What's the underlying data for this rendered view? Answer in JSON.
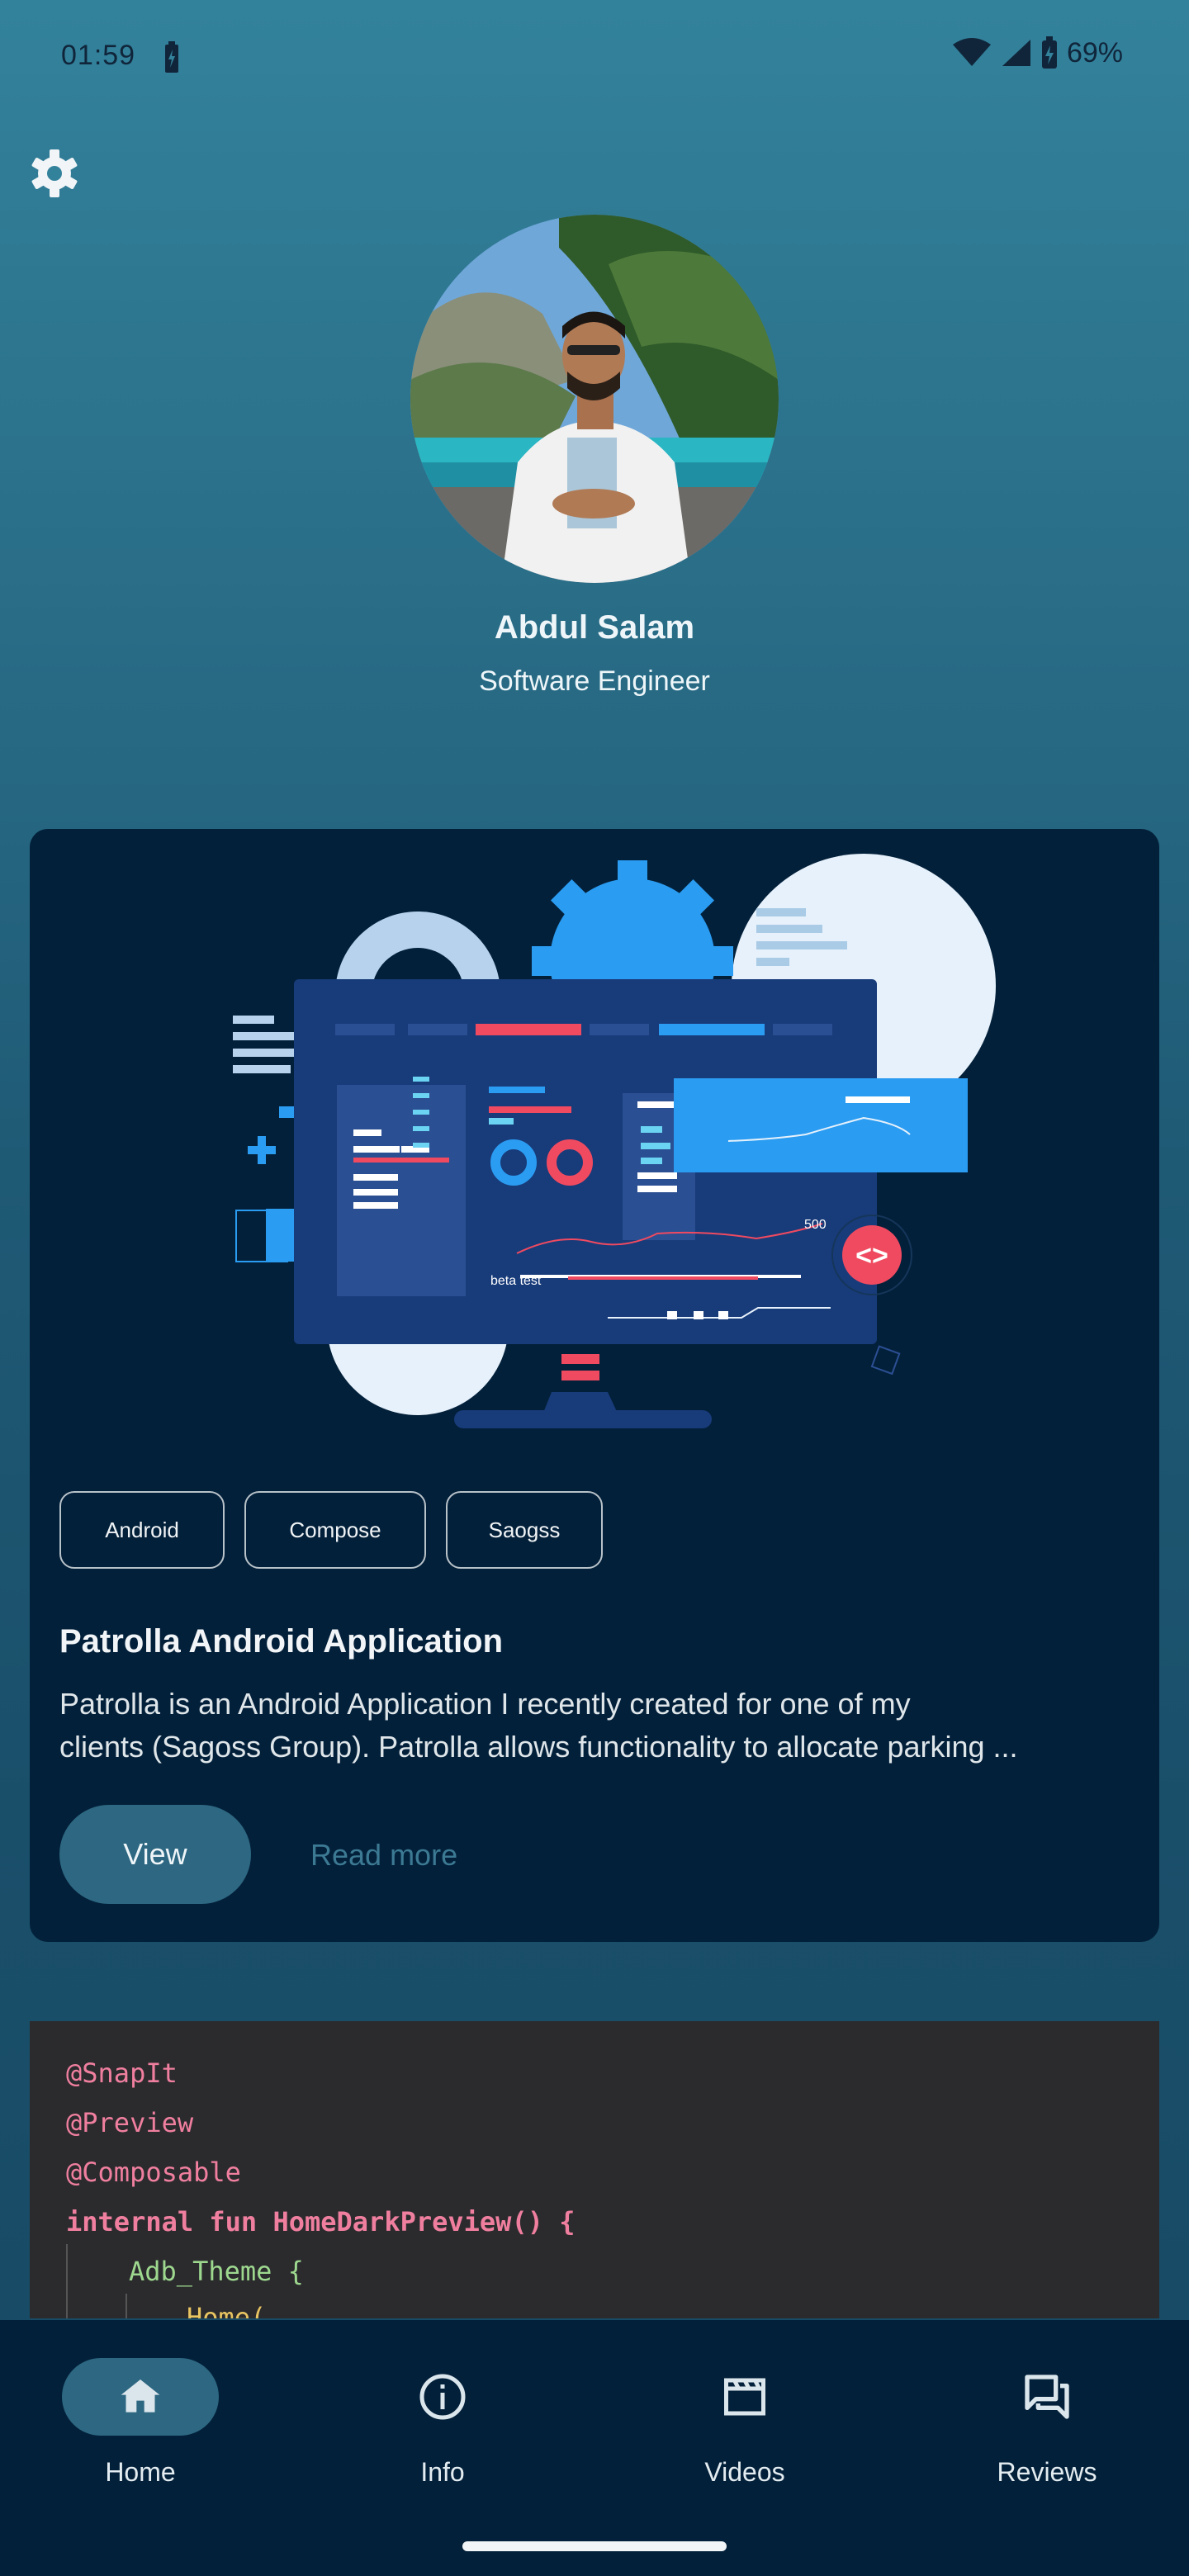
{
  "status_bar": {
    "time": "01:59",
    "battery_percent": "69%",
    "icons": [
      "battery-saver-icon",
      "wifi-icon",
      "signal-icon",
      "battery-icon"
    ]
  },
  "settings": {
    "icon": "gear-icon"
  },
  "profile": {
    "name": "Abdul Salam",
    "title": "Software Engineer"
  },
  "project": {
    "tags": [
      "Android",
      "Compose",
      "Saogss"
    ],
    "title": "Patrolla Android Application",
    "description_lines": [
      "Patrolla is an Android Application I recently created for one of my",
      "clients (Sagoss Group). Patrolla allows functionality to allocate parking ..."
    ],
    "view_label": "View",
    "read_more_label": "Read more",
    "illustration_labels": {
      "beta": "beta test",
      "value": "500",
      "code": "<>"
    }
  },
  "code_snippet": {
    "lines": [
      "@SnapIt",
      "@Preview",
      "@Composable",
      "internal fun HomeDarkPreview() {",
      "Adb_Theme {",
      "Home("
    ]
  },
  "bottom_nav": {
    "items": [
      {
        "label": "Home",
        "icon": "home-icon",
        "active": true
      },
      {
        "label": "Info",
        "icon": "info-icon",
        "active": false
      },
      {
        "label": "Videos",
        "icon": "clapperboard-icon",
        "active": false
      },
      {
        "label": "Reviews",
        "icon": "chat-bubbles-icon",
        "active": false
      }
    ]
  },
  "colors": {
    "card_background": "#03203a",
    "accent": "#2d6781",
    "nav_background": "#03203a"
  }
}
